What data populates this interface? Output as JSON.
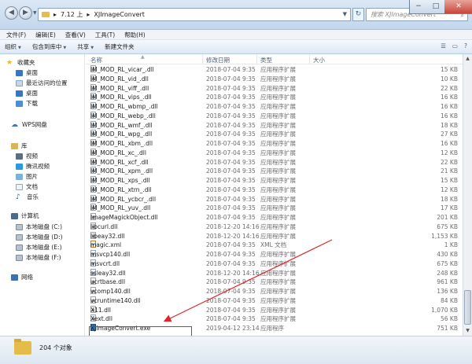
{
  "address": {
    "crumbs": [
      "7.12 上",
      "XJImageConvert"
    ],
    "sep": "▸"
  },
  "search": {
    "placeholder": "搜索 XJImageConvert"
  },
  "menu": [
    "文件(F)",
    "编辑(E)",
    "查看(V)",
    "工具(T)",
    "帮助(H)"
  ],
  "toolbar": {
    "organize": "组织",
    "include": "包含到库中",
    "share": "共享",
    "newfolder": "新建文件夹"
  },
  "nav": {
    "favorites": "收藏夹",
    "desktop": "桌面",
    "recent": "最近访问的位置",
    "desktop2": "桌面",
    "downloads": "下载",
    "wps": "WPS网盘",
    "library": "库",
    "videos": "视频",
    "tencent_video": "腾讯视频",
    "pictures": "图片",
    "documents": "文档",
    "music": "音乐",
    "computer": "计算机",
    "drive_c": "本地磁盘 (C:)",
    "drive_d": "本地磁盘 (D:)",
    "drive_e": "本地磁盘 (E:)",
    "drive_f": "本地磁盘 (F:)",
    "network": "网络"
  },
  "columns": {
    "name": "名称",
    "date": "修改日期",
    "type": "类型",
    "size": "大小"
  },
  "files": [
    {
      "name": "IM_MOD_RL_vicar_.dll",
      "date": "2018-07-04 9:35",
      "type": "应用程序扩展",
      "size": "15 KB",
      "kind": "dll"
    },
    {
      "name": "IM_MOD_RL_vid_.dll",
      "date": "2018-07-04 9:35",
      "type": "应用程序扩展",
      "size": "10 KB",
      "kind": "dll"
    },
    {
      "name": "IM_MOD_RL_viff_.dll",
      "date": "2018-07-04 9:35",
      "type": "应用程序扩展",
      "size": "22 KB",
      "kind": "dll"
    },
    {
      "name": "IM_MOD_RL_vips_.dll",
      "date": "2018-07-04 9:35",
      "type": "应用程序扩展",
      "size": "16 KB",
      "kind": "dll"
    },
    {
      "name": "IM_MOD_RL_wbmp_.dll",
      "date": "2018-07-04 9:35",
      "type": "应用程序扩展",
      "size": "16 KB",
      "kind": "dll"
    },
    {
      "name": "IM_MOD_RL_webp_.dll",
      "date": "2018-07-04 9:35",
      "type": "应用程序扩展",
      "size": "16 KB",
      "kind": "dll"
    },
    {
      "name": "IM_MOD_RL_wmf_.dll",
      "date": "2018-07-04 9:35",
      "type": "应用程序扩展",
      "size": "18 KB",
      "kind": "dll"
    },
    {
      "name": "IM_MOD_RL_wpg_.dll",
      "date": "2018-07-04 9:35",
      "type": "应用程序扩展",
      "size": "27 KB",
      "kind": "dll"
    },
    {
      "name": "IM_MOD_RL_xbm_.dll",
      "date": "2018-07-04 9:35",
      "type": "应用程序扩展",
      "size": "16 KB",
      "kind": "dll"
    },
    {
      "name": "IM_MOD_RL_xc_.dll",
      "date": "2018-07-04 9:35",
      "type": "应用程序扩展",
      "size": "12 KB",
      "kind": "dll"
    },
    {
      "name": "IM_MOD_RL_xcf_.dll",
      "date": "2018-07-04 9:35",
      "type": "应用程序扩展",
      "size": "22 KB",
      "kind": "dll"
    },
    {
      "name": "IM_MOD_RL_xpm_.dll",
      "date": "2018-07-04 9:35",
      "type": "应用程序扩展",
      "size": "21 KB",
      "kind": "dll"
    },
    {
      "name": "IM_MOD_RL_xps_.dll",
      "date": "2018-07-04 9:35",
      "type": "应用程序扩展",
      "size": "15 KB",
      "kind": "dll"
    },
    {
      "name": "IM_MOD_RL_xtrn_.dll",
      "date": "2018-07-04 9:35",
      "type": "应用程序扩展",
      "size": "12 KB",
      "kind": "dll"
    },
    {
      "name": "IM_MOD_RL_ycbcr_.dll",
      "date": "2018-07-04 9:35",
      "type": "应用程序扩展",
      "size": "18 KB",
      "kind": "dll"
    },
    {
      "name": "IM_MOD_RL_yuv_.dll",
      "date": "2018-07-04 9:35",
      "type": "应用程序扩展",
      "size": "17 KB",
      "kind": "dll"
    },
    {
      "name": "ImageMagickObject.dll",
      "date": "2018-07-04 9:35",
      "type": "应用程序扩展",
      "size": "201 KB",
      "kind": "dll"
    },
    {
      "name": "libcurl.dll",
      "date": "2018-12-20 14:16",
      "type": "应用程序扩展",
      "size": "675 KB",
      "kind": "dll"
    },
    {
      "name": "libeay32.dll",
      "date": "2018-12-20 14:16",
      "type": "应用程序扩展",
      "size": "1,153 KB",
      "kind": "dll"
    },
    {
      "name": "magic.xml",
      "date": "2018-07-04 9:35",
      "type": "XML 文档",
      "size": "1 KB",
      "kind": "xml"
    },
    {
      "name": "msvcp140.dll",
      "date": "2018-07-04 9:35",
      "type": "应用程序扩展",
      "size": "430 KB",
      "kind": "dll"
    },
    {
      "name": "msvcrt.dll",
      "date": "2018-07-04 9:35",
      "type": "应用程序扩展",
      "size": "675 KB",
      "kind": "dll"
    },
    {
      "name": "ssleay32.dll",
      "date": "2018-12-20 14:16",
      "type": "应用程序扩展",
      "size": "248 KB",
      "kind": "dll"
    },
    {
      "name": "ucrtbase.dll",
      "date": "2018-07-04 9:35",
      "type": "应用程序扩展",
      "size": "961 KB",
      "kind": "dll"
    },
    {
      "name": "vcomp140.dll",
      "date": "2018-07-04 9:35",
      "type": "应用程序扩展",
      "size": "136 KB",
      "kind": "dll"
    },
    {
      "name": "vcruntime140.dll",
      "date": "2018-07-04 9:35",
      "type": "应用程序扩展",
      "size": "84 KB",
      "kind": "dll"
    },
    {
      "name": "X11.dll",
      "date": "2018-07-04 9:35",
      "type": "应用程序扩展",
      "size": "1,070 KB",
      "kind": "dll"
    },
    {
      "name": "Xext.dll",
      "date": "2018-07-04 9:35",
      "type": "应用程序扩展",
      "size": "56 KB",
      "kind": "dll"
    },
    {
      "name": "XJImageConvert.exe",
      "date": "2019-04-12 23:14",
      "type": "应用程序",
      "size": "751 KB",
      "kind": "exe"
    }
  ],
  "status": {
    "count": "204 个对象"
  },
  "colors": {
    "highlight": "#e0262b",
    "selection": "#cce8ff"
  }
}
